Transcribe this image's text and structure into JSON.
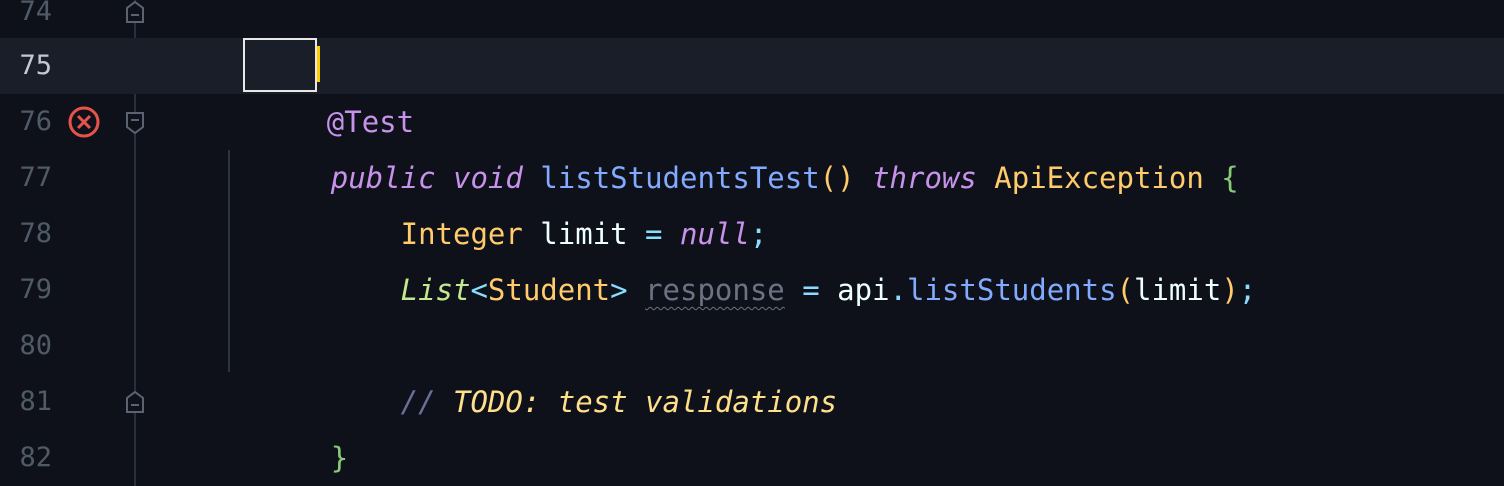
{
  "editor": {
    "lines": [
      {
        "number": "74",
        "tokens": [
          {
            "text": "  */",
            "class": "c-comment"
          }
        ]
      },
      {
        "number": "75",
        "tokens": [
          {
            "text": "@",
            "class": "c-at"
          },
          {
            "text": "Test",
            "class": "c-annot"
          }
        ]
      },
      {
        "number": "76",
        "tokens": [
          {
            "text": "public",
            "class": "c-keyword"
          },
          {
            "text": " ",
            "class": "c-var"
          },
          {
            "text": "void",
            "class": "c-keyword"
          },
          {
            "text": " ",
            "class": "c-var"
          },
          {
            "text": "listStudentsTest",
            "class": "c-fn"
          },
          {
            "text": "()",
            "class": "c-paren2"
          },
          {
            "text": " ",
            "class": "c-var"
          },
          {
            "text": "throws",
            "class": "c-keyword"
          },
          {
            "text": " ",
            "class": "c-var"
          },
          {
            "text": "ApiException",
            "class": "c-type"
          },
          {
            "text": " ",
            "class": "c-var"
          },
          {
            "text": "{",
            "class": "c-brace"
          }
        ]
      },
      {
        "number": "77",
        "tokens": [
          {
            "text": "    Integer",
            "class": "c-type"
          },
          {
            "text": " limit ",
            "class": "c-var"
          },
          {
            "text": "=",
            "class": "c-op"
          },
          {
            "text": " ",
            "class": "c-var"
          },
          {
            "text": "null",
            "class": "c-keyword"
          },
          {
            "text": ";",
            "class": "c-semi"
          }
        ]
      },
      {
        "number": "78",
        "tokens": [
          {
            "text": "    List",
            "class": "c-generic"
          },
          {
            "text": "<",
            "class": "c-op"
          },
          {
            "text": "Student",
            "class": "c-type"
          },
          {
            "text": ">",
            "class": "c-op"
          },
          {
            "text": " ",
            "class": "c-var"
          },
          {
            "text": "response",
            "class": "c-unused"
          },
          {
            "text": " ",
            "class": "c-var"
          },
          {
            "text": "=",
            "class": "c-op"
          },
          {
            "text": " api",
            "class": "c-var"
          },
          {
            "text": ".",
            "class": "c-op"
          },
          {
            "text": "listStudents",
            "class": "c-fn"
          },
          {
            "text": "(",
            "class": "c-paren2"
          },
          {
            "text": "limit",
            "class": "c-var"
          },
          {
            "text": ")",
            "class": "c-paren2"
          },
          {
            "text": ";",
            "class": "c-semi"
          }
        ]
      },
      {
        "number": "79",
        "tokens": []
      },
      {
        "number": "80",
        "tokens": [
          {
            "text": "    //",
            "class": "c-comment"
          },
          {
            "text": " TODO: test validations",
            "class": "c-todo"
          }
        ]
      },
      {
        "number": "81",
        "tokens": [
          {
            "text": "}",
            "class": "c-brace"
          }
        ]
      },
      {
        "number": "82",
        "tokens": []
      }
    ],
    "current_line": "75",
    "error_line": "76"
  },
  "colors": {
    "background": "#0f111a",
    "current_line": "#1a1e29",
    "error": "#e5534b",
    "caret": "#ffcc00"
  }
}
